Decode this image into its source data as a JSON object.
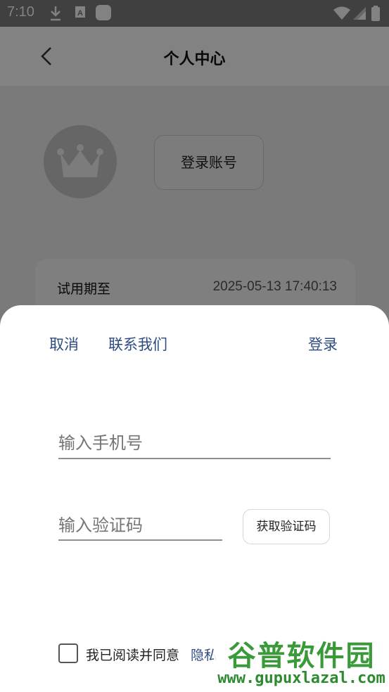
{
  "status_bar": {
    "time": "7:10",
    "icons": [
      "download-icon",
      "a-box-icon",
      "app-square-icon",
      "wifi-icon",
      "signal-icon",
      "battery-icon"
    ]
  },
  "page": {
    "title": "个人中心",
    "login_button": "登录账号",
    "trial": {
      "label": "试用期至",
      "value": "2025-05-13 17:40:13"
    }
  },
  "sheet": {
    "cancel": "取消",
    "contact": "联系我们",
    "login": "登录",
    "phone_placeholder": "输入手机号",
    "code_placeholder": "输入验证码",
    "get_code": "获取验证码",
    "agree_text": "我已阅读并同意",
    "privacy_link": "隐私"
  },
  "watermark": {
    "title": "谷普软件园",
    "url": "www.gupuxlazal.com"
  },
  "colors": {
    "link": "#2f4c80",
    "scrim": "rgba(0,0,0,0.49)",
    "sheet_bg": "#ffffff"
  }
}
